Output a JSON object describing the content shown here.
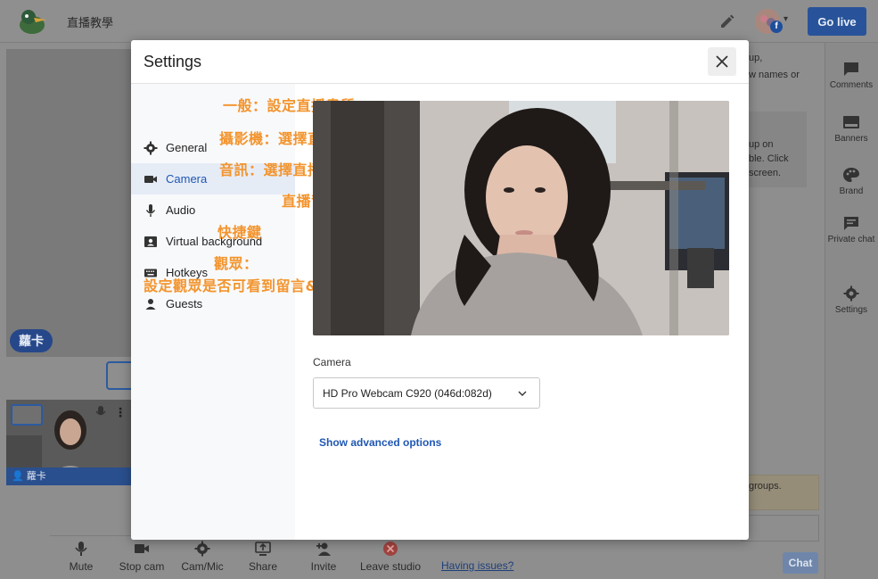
{
  "app": {
    "studio_title": "直播教學",
    "go_live_label": "Go live",
    "fb_badge": "f",
    "stage_name": "蘿卡",
    "thumb_name": "蘿卡",
    "thumb_dots": "⋮"
  },
  "bottombar": {
    "items": [
      {
        "label": "Mute",
        "icon": "mic-icon"
      },
      {
        "label": "Stop cam",
        "icon": "camera-icon"
      },
      {
        "label": "Cam/Mic",
        "icon": "gear-icon"
      },
      {
        "label": "Share",
        "icon": "share-screen-icon"
      },
      {
        "label": "Invite",
        "icon": "add-person-icon"
      },
      {
        "label": "Leave studio",
        "icon": "leave-icon"
      }
    ],
    "help_link": "Having issues?"
  },
  "right_panel": {
    "fragment_1a": "up,",
    "fragment_1b": "w names or",
    "fragment_2a": "up on",
    "fragment_2b": "ble. Click",
    "fragment_2c": "screen.",
    "fragment_3": "groups.",
    "chat_label": "Chat"
  },
  "sidebar": {
    "items": [
      {
        "label": "Comments",
        "icon": "comment-icon"
      },
      {
        "label": "Banners",
        "icon": "banner-icon"
      },
      {
        "label": "Brand",
        "icon": "palette-icon"
      },
      {
        "label": "Private chat",
        "icon": "private-chat-icon"
      },
      {
        "label": "Settings",
        "icon": "gear-icon"
      }
    ]
  },
  "modal": {
    "title": "Settings",
    "nav": [
      {
        "label": "General",
        "annotation": "一般：設定直播畫質",
        "icon": "gear-icon"
      },
      {
        "label": "Camera",
        "annotation": "攝影機：選擇直播鏡頭",
        "icon": "camera-icon",
        "active": true
      },
      {
        "label": "Audio",
        "annotation": "音訊：選擇直播麥克風",
        "icon": "mic-icon"
      },
      {
        "label": "Virtual background",
        "annotation": "直播背景",
        "icon": "portrait-icon"
      },
      {
        "label": "Hotkeys",
        "annotation": "快捷鍵",
        "icon": "keyboard-icon"
      },
      {
        "label": "Guests",
        "annotation": "觀眾：",
        "annotation_2": "設定觀眾是否可看到留言&設定黑名單",
        "icon": "person-icon"
      }
    ],
    "camera_label": "Camera",
    "camera_selected": "HD Pro Webcam C920 (046d:082d)",
    "advanced_link": "Show advanced options"
  },
  "colors": {
    "accent": "#1f57b3",
    "annotation": "#f3942d",
    "go_live": "#28539a"
  }
}
